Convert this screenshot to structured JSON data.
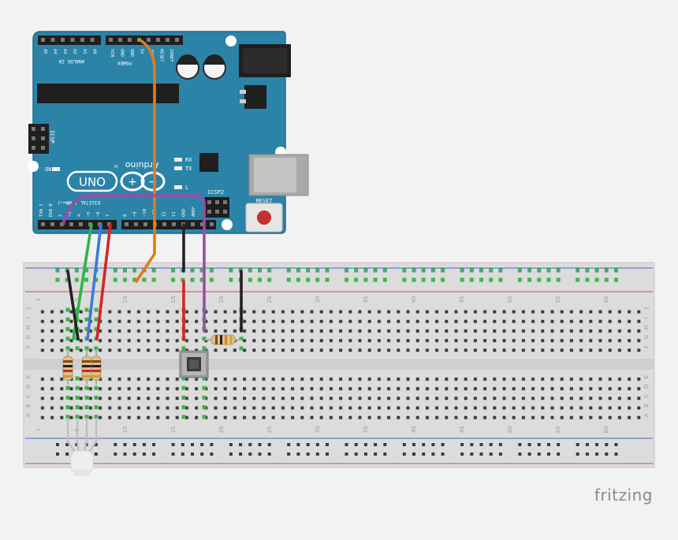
{
  "board": {
    "header_left_labels": [
      "A5",
      "A4",
      "A3",
      "A2",
      "A1",
      "A0"
    ],
    "analog_in_label": "ANALOG IN",
    "power_pin_labels": [
      "VIN",
      "GND",
      "GND",
      "5V",
      "3V3",
      "RESET",
      "IOREF"
    ],
    "power_label": "POWER",
    "icsp_label": "ICSP",
    "icsp2_label": "ICSP2",
    "on_label": "ON",
    "rx_label": "RX",
    "tx_label": "TX",
    "l_label": "L",
    "uno_label": "UNO",
    "brand_label": "Arduino",
    "tm_label": "TM",
    "digital_label": "DIGITAL (PWM=~)",
    "digital_pin_labels": [
      "TX0 1",
      "RX0 0",
      "2",
      "~3",
      "4",
      "~5",
      "~6",
      "7",
      "8",
      "~9",
      "~10",
      "~11",
      "12",
      "13",
      "GND",
      "AREF"
    ],
    "reset_label": "RESET",
    "colors": {
      "board": "#2b83a8",
      "board_edge": "#1f6b8c",
      "header": "#1f1f1f"
    }
  },
  "breadboard": {
    "column_numbers": [
      "1",
      "5",
      "10",
      "15",
      "20",
      "25",
      "30",
      "35",
      "40",
      "45",
      "50",
      "55",
      "60"
    ],
    "row_letters_top": [
      "J",
      "I",
      "H",
      "G",
      "F"
    ],
    "row_letters_bottom": [
      "E",
      "D",
      "C",
      "B",
      "A"
    ],
    "colors": {
      "body": "#dcdcdc",
      "hole": "#3b3b3b",
      "active": "#3cb54a",
      "rail_red": "#d94a4a",
      "rail_blue": "#4a62d9"
    }
  },
  "wires": [
    {
      "name": "5v-wire",
      "color": "#e07b1d"
    },
    {
      "name": "gnd-wire-board",
      "color": "#222222"
    },
    {
      "name": "pin2-wire",
      "color": "#9b4ca8"
    },
    {
      "name": "pin5-wire",
      "color": "#2fb34a"
    },
    {
      "name": "pin6-wire",
      "color": "#3a7bd5"
    },
    {
      "name": "pin3-wire",
      "color": "#d62424"
    },
    {
      "name": "gnd-led-wire",
      "color": "#222222"
    },
    {
      "name": "button-5v-wire",
      "color": "#d62424"
    },
    {
      "name": "pulldown-gnd-wire",
      "color": "#222222"
    }
  ],
  "footer": {
    "brand": "fritzing"
  }
}
